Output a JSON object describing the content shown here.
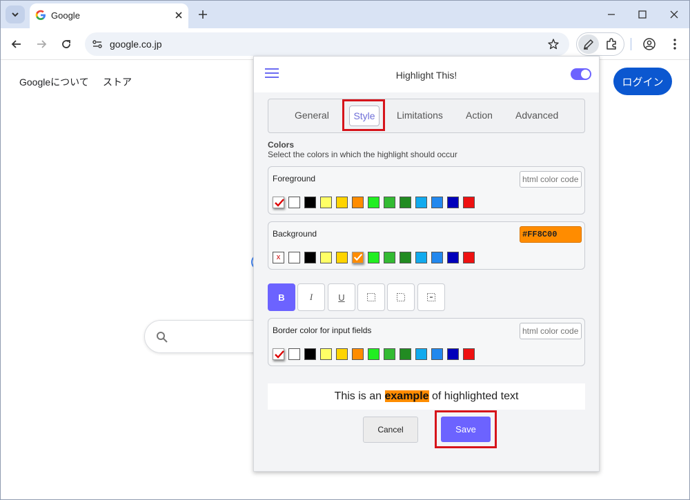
{
  "browser": {
    "tab_title": "Google",
    "url": "google.co.jp"
  },
  "google_page": {
    "links": [
      "Googleについて",
      "ストア"
    ],
    "login_label": "ログイン"
  },
  "popup": {
    "title": "Highlight This!",
    "enabled": true,
    "tabs": [
      "General",
      "Style",
      "Limitations",
      "Action",
      "Advanced"
    ],
    "active_tab": "Style",
    "colors_heading": "Colors",
    "colors_description": "Select the colors in which the highlight should occur",
    "foreground": {
      "label": "Foreground",
      "input_placeholder": "html color code",
      "selected": "default"
    },
    "background": {
      "label": "Background",
      "input_value": "#FF8C00",
      "none_marker": "x",
      "selected": "#FF8C00"
    },
    "border_color": {
      "label": "Border color for input fields",
      "input_placeholder": "html color code",
      "selected": "default"
    },
    "palette": [
      "#FFFFFF",
      "#000000",
      "#FFFF66",
      "#FFD400",
      "#FF8C00",
      "#22EE22",
      "#33BB33",
      "#228B22",
      "#11AAEE",
      "#2288EE",
      "#0000BB",
      "#EE1111"
    ],
    "format_buttons": [
      "B",
      "I",
      "U"
    ],
    "preview": {
      "before": "This is an ",
      "highlight": "example",
      "after": " of highlighted text"
    },
    "cancel_label": "Cancel",
    "save_label": "Save"
  },
  "colors": {
    "accent": "#6C63FF",
    "annotation_red": "#D6141B",
    "google_blue": "#0B57D0"
  }
}
